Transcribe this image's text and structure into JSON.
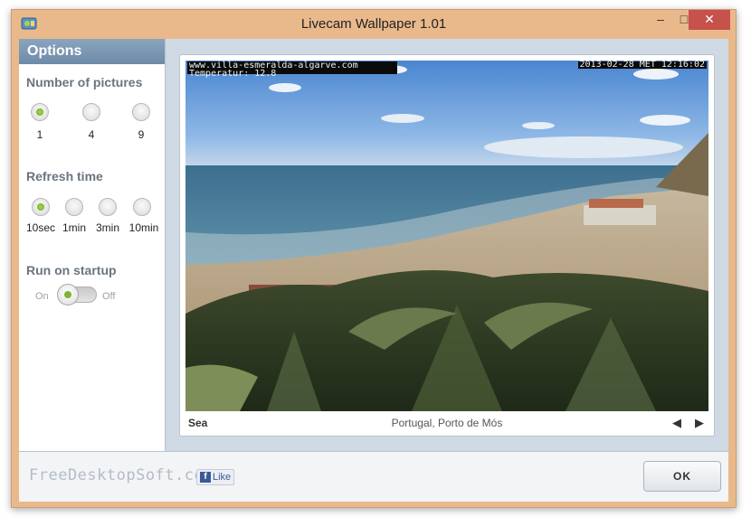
{
  "window": {
    "title": "Livecam Wallpaper 1.01",
    "minimize": "–",
    "maximize": "□",
    "close": "✕"
  },
  "sidebar": {
    "header": "Options",
    "pictures": {
      "title": "Number of pictures",
      "options": [
        "1",
        "4",
        "9"
      ],
      "selected": "1"
    },
    "refresh": {
      "title": "Refresh time",
      "options": [
        "10sec",
        "1min",
        "3min",
        "10min"
      ],
      "selected": "10sec"
    },
    "startup": {
      "title": "Run on startup",
      "on_label": "On",
      "off_label": "Off",
      "value": "On"
    }
  },
  "camera": {
    "overlay_url": "www.villa-esmeralda-algarve.com",
    "overlay_temp": "Temperatur: 12.8",
    "overlay_datetime": "2013-02-28 MET 12:16:02",
    "category": "Sea",
    "location": "Portugal, Porto de Mós",
    "prev": "◀",
    "next": "▶"
  },
  "footer": {
    "brand": "FreeDesktopSoft.com",
    "like_icon": "f",
    "like_label": "Like",
    "ok_label": "OK"
  },
  "colors": {
    "accent_green": "#7db534",
    "close_red": "#c7514b",
    "window_frame": "#e9b98c"
  }
}
